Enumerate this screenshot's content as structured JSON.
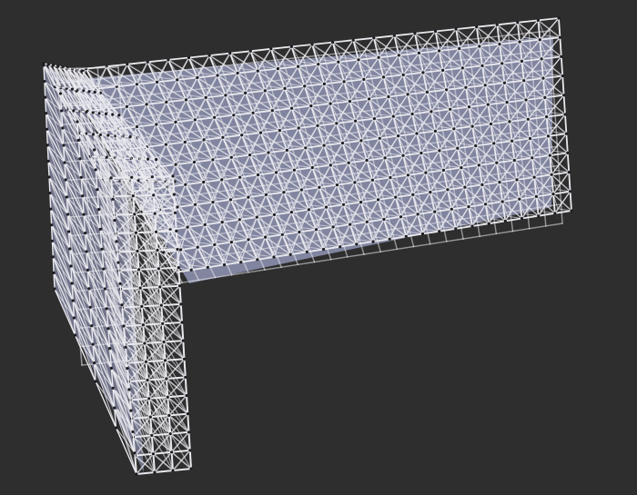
{
  "scene": {
    "background": "#2e2e2e",
    "panel_fill": "#9ea3c6",
    "strut_color": "#e9e9ee",
    "strut_shadow": "#6a6a78",
    "node_color": "#1c1c22",
    "long_wall": {
      "cols": 24,
      "rows": 10
    },
    "short_wall": {
      "cols": 6,
      "rows": 20
    },
    "connector": {
      "cols": 8,
      "rows": 5
    }
  }
}
